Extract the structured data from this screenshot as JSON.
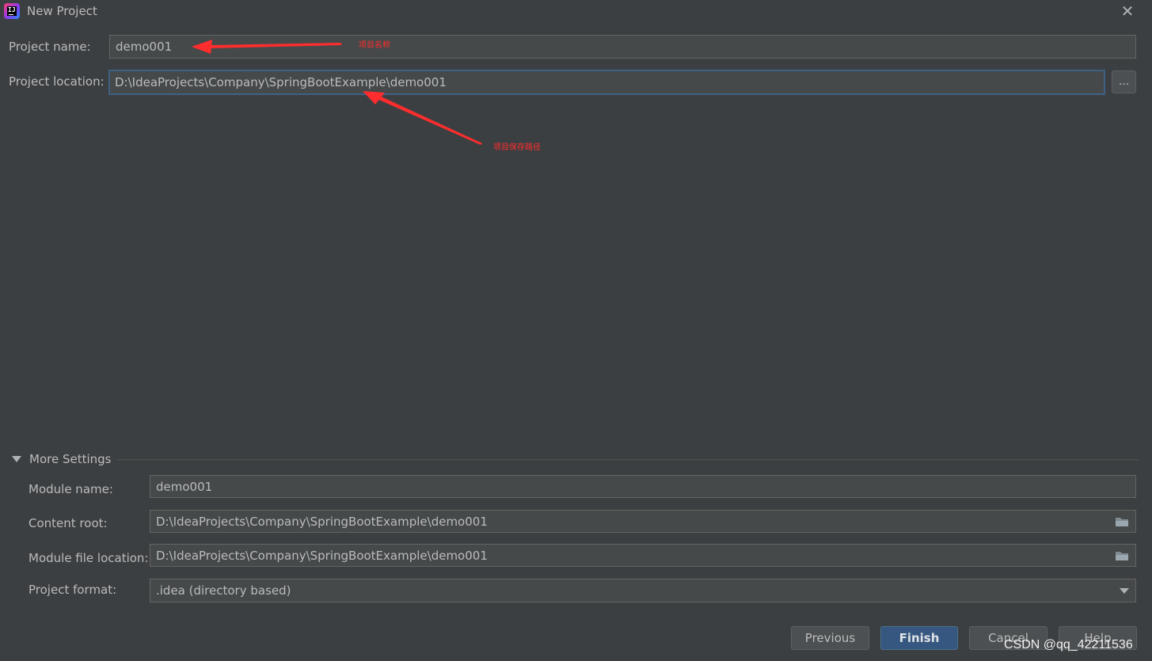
{
  "window": {
    "title": "New Project",
    "close_glyph": "✕"
  },
  "project": {
    "name_label": "Project name:",
    "name_value": "demo001",
    "location_label": "Project location:",
    "location_value": "D:\\IdeaProjects\\Company\\SpringBootExample\\demo001",
    "browse_label": "..."
  },
  "annotations": {
    "name_note": "项目名称",
    "location_note": "项目保存路径",
    "arrow_color": "#ff2d2d"
  },
  "more_settings": {
    "header": "More Settings",
    "module_name_label": "Module name:",
    "module_name_value": "demo001",
    "content_root_label": "Content root:",
    "content_root_value": "D:\\IdeaProjects\\Company\\SpringBootExample\\demo001",
    "module_file_label": "Module file location:",
    "module_file_value": "D:\\IdeaProjects\\Company\\SpringBootExample\\demo001",
    "format_label": "Project format:",
    "format_value": ".idea (directory based)"
  },
  "buttons": {
    "previous": "Previous",
    "finish": "Finish",
    "cancel": "Cancel",
    "help": "Help"
  },
  "watermark": "CSDN @qq_42211536",
  "icons": [
    "intellij-app-icon",
    "close-icon",
    "folder-icon",
    "chevron-down-icon",
    "triangle-down-icon"
  ]
}
